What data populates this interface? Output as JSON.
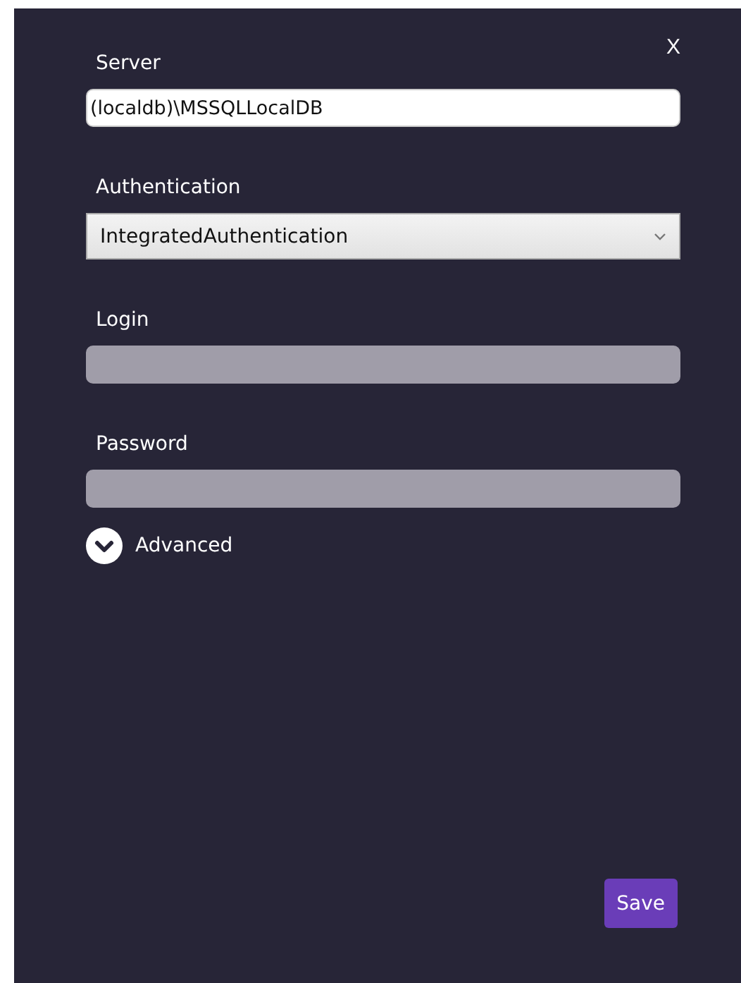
{
  "close_label": "X",
  "fields": [
    {
      "kind": "text",
      "label": "Server",
      "value": "(localdb)\\MSSQLLocalDB",
      "disabled": false
    },
    {
      "kind": "select",
      "label": "Authentication",
      "value": "IntegratedAuthentication",
      "disabled": false
    },
    {
      "kind": "text",
      "label": "Login",
      "disabled": true
    },
    {
      "kind": "password",
      "label": "Password",
      "disabled": true
    }
  ],
  "advanced": {
    "label": "Advanced",
    "expanded": false
  },
  "save_button": "Save"
}
